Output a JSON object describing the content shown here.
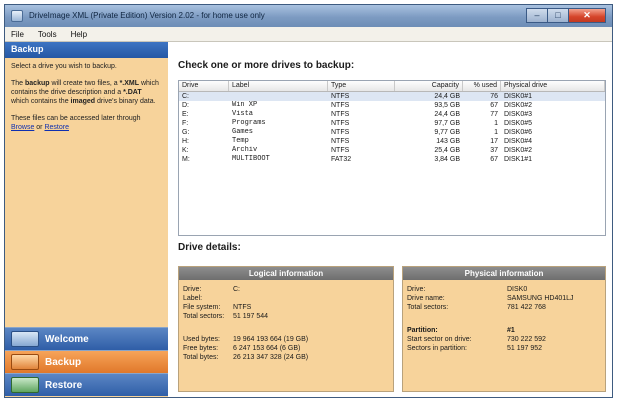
{
  "window": {
    "title": "DriveImage XML (Private Edition) Version 2.02 - for home use only",
    "controls": [
      "–",
      "□",
      "✕"
    ]
  },
  "menu": [
    "File",
    "Tools",
    "Help"
  ],
  "left": {
    "header": "Backup",
    "help": {
      "p1": "Select a drive you wish to backup.",
      "p2_pre": "The ",
      "p2_b1": "backup",
      "p2_mid1": " will create two files, a ",
      "p2_b2": "*.XML",
      "p2_mid2": " which contains the drive description and a ",
      "p2_b3": "*.DAT",
      "p2_mid3": " which contains the ",
      "p2_b4": "imaged",
      "p2_end": " drive's binary data.",
      "p3_pre": "These files can be accessed later through ",
      "link_browse": "Browse",
      "p3_mid": " or ",
      "link_restore": "Restore"
    },
    "nav": [
      {
        "label": "Welcome",
        "icon": "welcome-icon"
      },
      {
        "label": "Backup",
        "icon": "backup-icon"
      },
      {
        "label": "Restore",
        "icon": "restore-icon"
      }
    ]
  },
  "main": {
    "drives_title": "Check one or more drives to backup:",
    "table": {
      "columns": [
        "Drive",
        "Label",
        "Type",
        "Capacity",
        "% used",
        "Physical drive"
      ],
      "rows": [
        {
          "drive": "C:",
          "label": "",
          "type": "NTFS",
          "capacity": "24,4 GB",
          "used": "76",
          "phys": "DISK0#1"
        },
        {
          "drive": "D:",
          "label": "Win XP",
          "type": "NTFS",
          "capacity": "93,5 GB",
          "used": "67",
          "phys": "DISK0#2"
        },
        {
          "drive": "E:",
          "label": "Vista",
          "type": "NTFS",
          "capacity": "24,4 GB",
          "used": "77",
          "phys": "DISK0#3"
        },
        {
          "drive": "F:",
          "label": "Programs",
          "type": "NTFS",
          "capacity": "97,7 GB",
          "used": "1",
          "phys": "DISK0#5"
        },
        {
          "drive": "G:",
          "label": "Games",
          "type": "NTFS",
          "capacity": "9,77 GB",
          "used": "1",
          "phys": "DISK0#6"
        },
        {
          "drive": "H:",
          "label": "Temp",
          "type": "NTFS",
          "capacity": "143 GB",
          "used": "17",
          "phys": "DISK0#4"
        },
        {
          "drive": "K:",
          "label": "Archiv",
          "type": "NTFS",
          "capacity": "25,4 GB",
          "used": "37",
          "phys": "DISK0#2"
        },
        {
          "drive": "M:",
          "label": "MULTIBOOT",
          "type": "FAT32",
          "capacity": "3,84 GB",
          "used": "67",
          "phys": "DISK1#1"
        }
      ]
    },
    "details_title": "Drive details:",
    "logical": {
      "header": "Logical information",
      "drive_k": "Drive:",
      "drive_v": "C:",
      "label_k": "Label:",
      "label_v": "",
      "fs_k": "File system:",
      "fs_v": "NTFS",
      "sectors_k": "Total sectors:",
      "sectors_v": "51 197 544",
      "used_k": "Used bytes:",
      "used_v": "19 964 193 664 (19 GB)",
      "free_k": "Free bytes:",
      "free_v": "6 247 153 664 (6 GB)",
      "total_k": "Total bytes:",
      "total_v": "26 213 347 328 (24 GB)"
    },
    "physical": {
      "header": "Physical information",
      "drive_k": "Drive:",
      "drive_v": "DISK0",
      "name_k": "Drive name:",
      "name_v": "SAMSUNG HD401LJ",
      "sectors_k": "Total sectors:",
      "sectors_v": "781 422 768",
      "part_k": "Partition:",
      "part_v": "#1",
      "start_k": "Start sector on drive:",
      "start_v": "730 222 592",
      "secpart_k": "Sectors in partition:",
      "secpart_v": "51 197 952"
    }
  },
  "colors": {
    "accent": "#2f5ea7",
    "panel_bg": "#f7d39b",
    "active_nav": "#e0782a",
    "grey_header": "#7a7a7a"
  }
}
